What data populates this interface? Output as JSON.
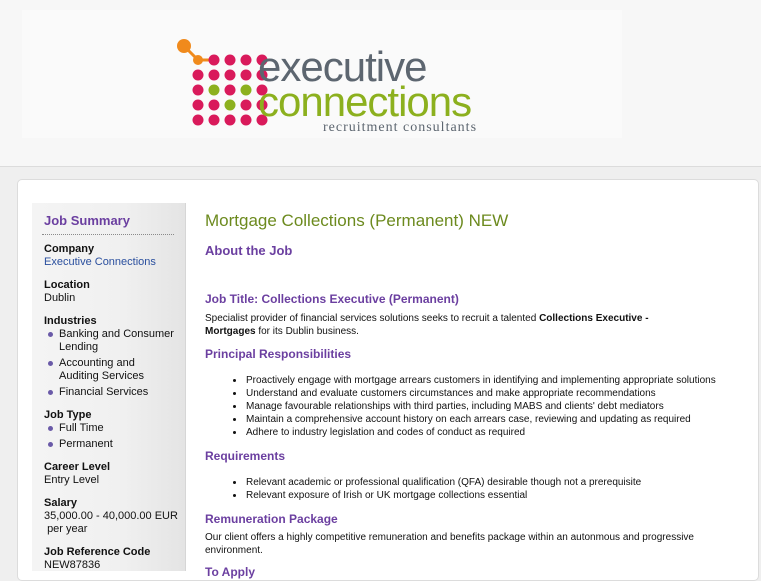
{
  "logo": {
    "line1": "executive",
    "line2": "connections",
    "tagline": "recruitment consultants",
    "colors": {
      "orange": "#f08a1c",
      "pink": "#d91a5b",
      "green": "#8cb01e",
      "grey": "#5d6670"
    }
  },
  "sidebar": {
    "title": "Job Summary",
    "company_label": "Company",
    "company_value": "Executive Connections",
    "location_label": "Location",
    "location_value": "Dublin",
    "industries_label": "Industries",
    "industries": [
      {
        "line1": "Banking and Consumer",
        "line2": "Lending"
      },
      {
        "line1": "Accounting and",
        "line2": "Auditing Services"
      },
      {
        "line1": "Financial Services",
        "line2": ""
      }
    ],
    "job_type_label": "Job Type",
    "job_types": [
      "Full Time",
      "Permanent"
    ],
    "career_label": "Career Level",
    "career_value": "Entry Level",
    "salary_label": "Salary",
    "salary_line1": "35,000.00 - 40,000.00 EUR",
    "salary_line2": "per year",
    "ref_label": "Job Reference Code",
    "ref_value": "NEW87836"
  },
  "main": {
    "title": "Mortgage Collections (Permanent) NEW",
    "about_heading": "About the Job",
    "job_title_heading": "Job Title: Collections Executive (Permanent)",
    "intro_1": "Specialist provider of financial services solutions seeks to recruit a talented ",
    "intro_bold_1": "Collections Executive -",
    "intro_bold_2": "Mortgages",
    "intro_2": " for its Dublin business.",
    "responsibilities_heading": "Principal Responsibilities",
    "responsibilities": [
      "Proactively engage with mortgage arrears customers in identifying and implementing appropriate solutions",
      "Understand and evaluate customers circumstances and make appropriate recommendations",
      "Manage favourable relationships with third parties, including MABS and clients' debt mediators",
      "Maintain a comprehensive account history on each arrears case, reviewing and updating as required",
      "Adhere to industry legislation and codes of conduct as required"
    ],
    "requirements_heading": "Requirements",
    "requirements": [
      "Relevant academic or professional qualification (QFA) desirable though not a prerequisite",
      "Relevant exposure of Irish or UK mortgage collections essential"
    ],
    "remuneration_heading": "Remuneration Package",
    "remuneration_line1": "Our client offers a highly competitive remuneration and benefits package within an autonmous and progressive",
    "remuneration_line2": "environment.",
    "cut_heading": "To Apply"
  }
}
